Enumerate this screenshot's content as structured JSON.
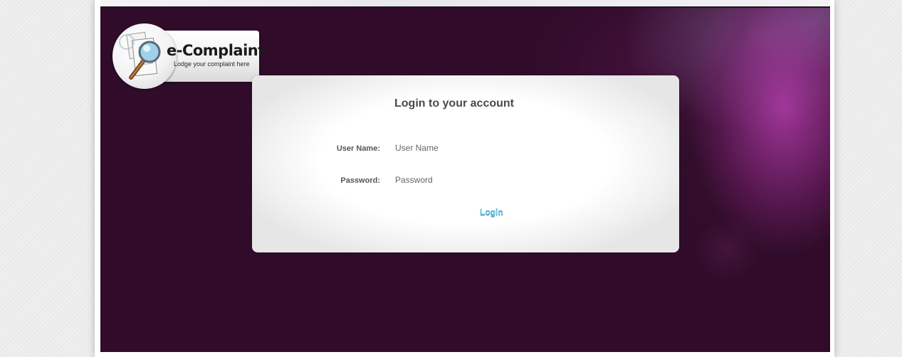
{
  "logo": {
    "title": "e-Complaint",
    "tagline": "Lodge your complaint here",
    "icon": "magnifier-document-icon"
  },
  "login": {
    "title": "Login to your account",
    "username_label": "User Name:",
    "username_placeholder": "User Name",
    "username_value": "",
    "password_label": "Password:",
    "password_placeholder": "Password",
    "password_value": "",
    "submit_label": "Login"
  },
  "colors": {
    "hero_background": "#300c2a",
    "hero_glow": "#b03aa8",
    "link_accent": "#6cc5e6",
    "card_background": "#ffffff"
  }
}
